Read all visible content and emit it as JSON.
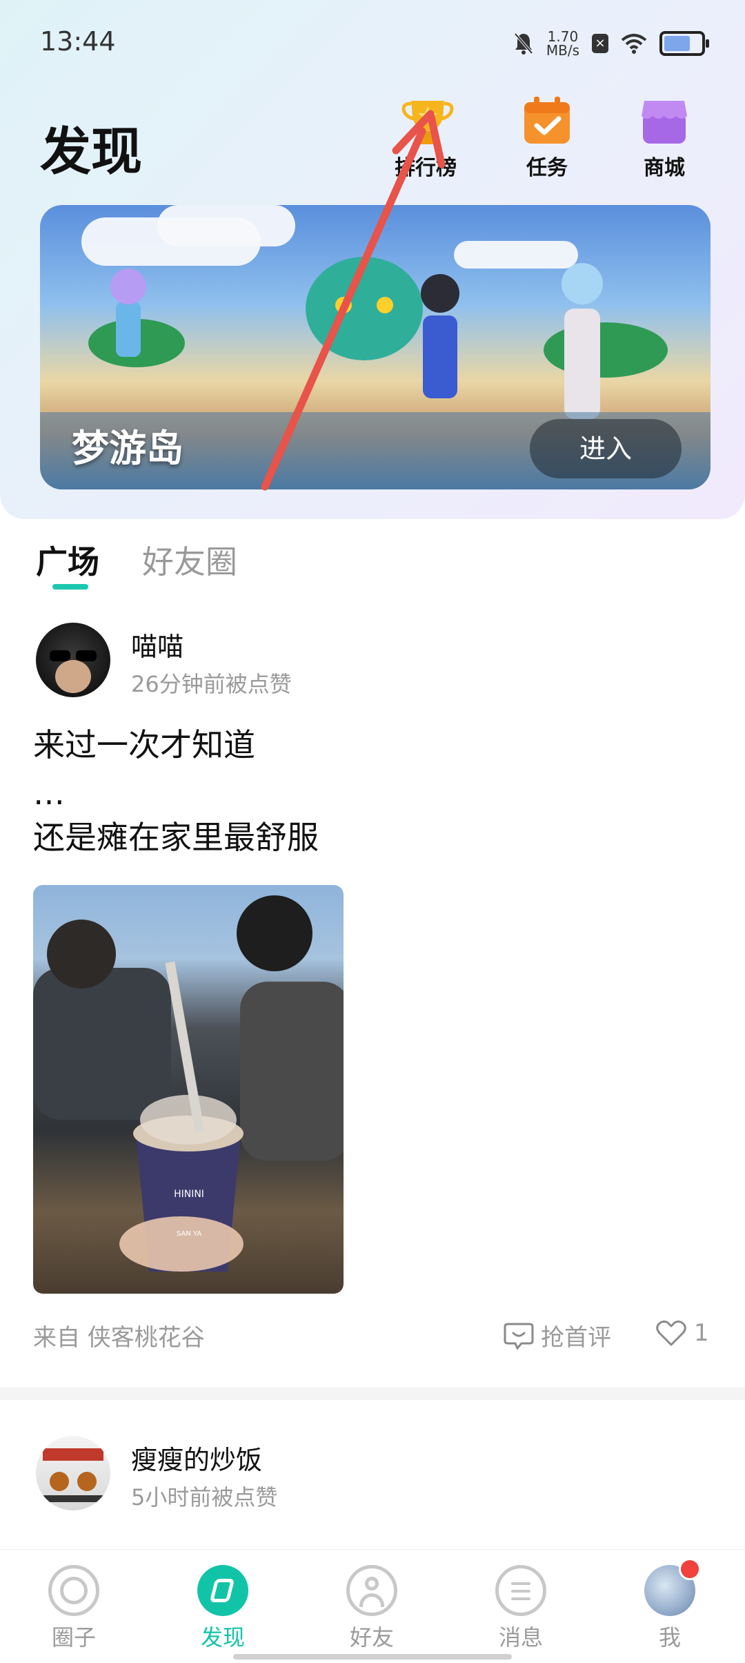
{
  "status_bar": {
    "time": "13:44",
    "net_speed_value": "1.70",
    "net_speed_unit": "MB/s",
    "battery_level": 0.85
  },
  "header": {
    "title": "发现",
    "actions": [
      {
        "label": "排行榜",
        "icon": "trophy-icon"
      },
      {
        "label": "任务",
        "icon": "calendar-check-icon"
      },
      {
        "label": "商城",
        "icon": "shop-icon"
      }
    ]
  },
  "banner": {
    "title": "梦游岛",
    "enter_label": "进入"
  },
  "tabs": [
    {
      "label": "广场",
      "active": true
    },
    {
      "label": "好友圈",
      "active": false
    }
  ],
  "posts": [
    {
      "user": "喵喵",
      "meta": "26分钟前被点赞",
      "text_lines": [
        "来过一次才知道",
        "…",
        "还是瘫在家里最舒服"
      ],
      "photo_cup_text": "HININI",
      "photo_cup_sub": "SAN YA",
      "source": "来自 侠客桃花谷",
      "comment_label": "抢首评",
      "likes": "1"
    },
    {
      "user": "瘦瘦的炒饭",
      "meta": "5小时前被点赞"
    }
  ],
  "bottom_nav": [
    {
      "label": "圈子",
      "icon": "circle-icon",
      "active": false
    },
    {
      "label": "发现",
      "icon": "discover-icon",
      "active": true
    },
    {
      "label": "好友",
      "icon": "friends-icon",
      "active": false
    },
    {
      "label": "消息",
      "icon": "message-icon",
      "active": false
    },
    {
      "label": "我",
      "icon": "avatar-icon",
      "active": false,
      "badge": true
    }
  ],
  "colors": {
    "accent": "#12c4a7",
    "annotation_arrow": "#e8534a",
    "badge": "#f0413c"
  }
}
